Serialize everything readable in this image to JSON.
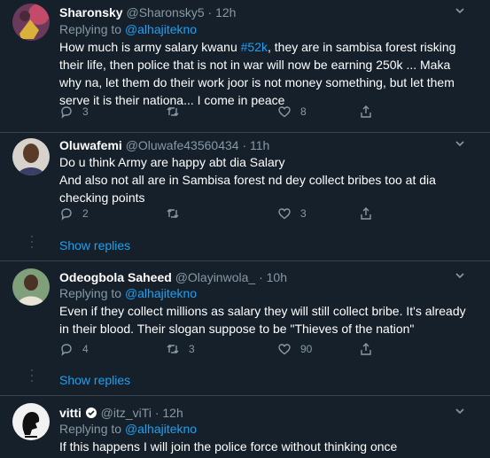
{
  "tweets": [
    {
      "name": "Sharonsky",
      "handle": "@Sharonsky5",
      "time": "12h",
      "replying_label": "Replying to ",
      "replying_to": "@alhajitekno",
      "text_pre": "How much is army salary kwanu ",
      "hashtag": "#52k",
      "text_post": ", they are in sambisa forest risking their life, then police that is not in war will now be earning 250k ... Maka why na, let them do their work joor is not money something, but let them serve it is their nationa... I come in peace",
      "replies": "3",
      "retweets": "",
      "likes": "8"
    },
    {
      "name": "Oluwafemi",
      "handle": "@Oluwafe43560434",
      "time": "11h",
      "text": "Do u think Army are happy abt dia Salary\nAnd also not all are in Sambisa forest nd dey collect bribes too at dia checking points",
      "replies": "2",
      "retweets": "",
      "likes": "3"
    },
    {
      "name": "Odeogbola Saheed",
      "handle": "@Olayinwola_",
      "time": "10h",
      "replying_label": "Replying to ",
      "replying_to": "@alhajitekno",
      "text": "Even if they collect millions as salary they will still collect bribe. It's already in their blood. Their slogan suppose to be \"Thieves of the nation\"",
      "replies": "4",
      "retweets": "3",
      "likes": "90"
    },
    {
      "name": "vitti",
      "handle": "@itz_viTi",
      "time": "12h",
      "replying_label": "Replying to ",
      "replying_to": "@alhajitekno",
      "text": "If this happens I will join the police force without thinking once"
    }
  ],
  "show_replies": "Show replies",
  "dot": "·",
  "colors": {
    "background": "#15202b",
    "accent": "#1da1f2",
    "muted": "#8899a6",
    "border": "#38444d"
  }
}
